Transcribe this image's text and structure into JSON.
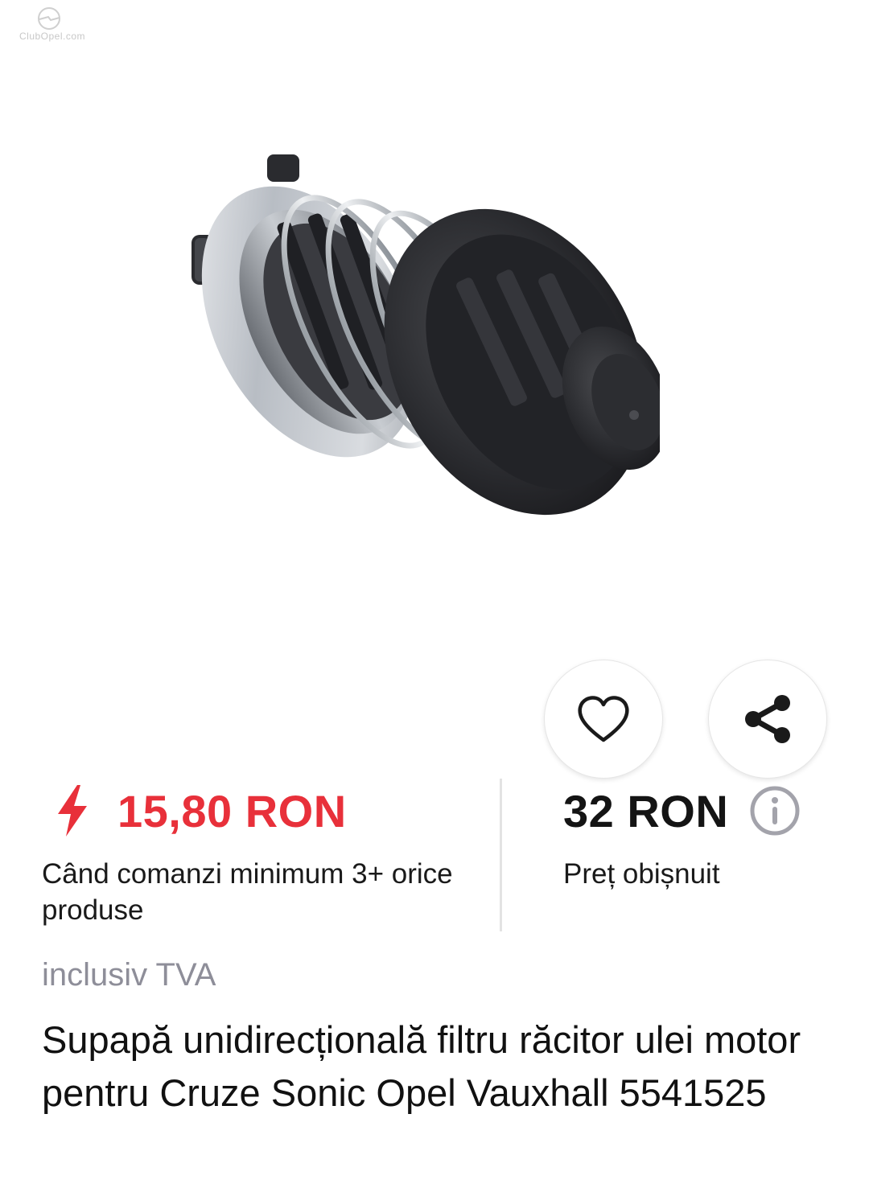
{
  "watermark": {
    "text": "ClubOpel.com"
  },
  "product": {
    "image_alt": "Supapă unidirecțională filtru răcitor ulei",
    "image_icon": "oil-cooler-check-valve",
    "title": "Supapă unidirecțională filtru răcitor ulei motor pentru Cruze Sonic Opel Vauxhall 5541525"
  },
  "actions": {
    "favorite_icon": "heart-icon",
    "share_icon": "share-icon"
  },
  "pricing": {
    "promo_icon": "lightning-bolt-icon",
    "promo_price": "15,80 RON",
    "promo_note": "Când comanzi minimum 3+ orice produse",
    "regular_price": "32 RON",
    "regular_label": "Preț obișnuit",
    "info_icon": "info-icon",
    "vat_note": "inclusiv TVA"
  },
  "colors": {
    "promo_red": "#e8303a",
    "muted_gray": "#8e8e99",
    "text_dark": "#111111"
  }
}
